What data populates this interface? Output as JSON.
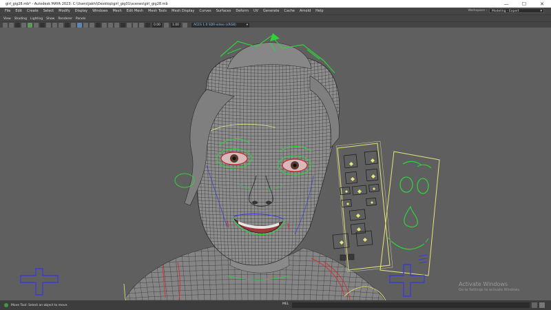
{
  "window": {
    "title": "girl_gig28.mb* - Autodesk MAYA 2023: C:\\Users\\Jakhi\\Desktop\\girl_gig01\\scenes\\girl_gig28.mb",
    "minimize": "—",
    "maximize": "☐",
    "close": "✕"
  },
  "menubar": {
    "items": [
      "File",
      "Edit",
      "Create",
      "Select",
      "Modify",
      "Display",
      "Windows",
      "Mesh",
      "Edit Mesh",
      "Mesh Tools",
      "Mesh Display",
      "Curves",
      "Surfaces",
      "Deform",
      "UV",
      "Generate",
      "Cache",
      "Arnold",
      "Help"
    ],
    "workspace_label": "Workspace :",
    "workspace_value": "Modeling - Expert"
  },
  "panel_menu": {
    "items": [
      "View",
      "Shading",
      "Lighting",
      "Show",
      "Renderer",
      "Panels"
    ]
  },
  "shelf": {
    "field1": "0.00",
    "field2": "1.00",
    "colorspace": "ACES 1.0 SDR-video (sRGB)"
  },
  "status": {
    "message": "Move Tool: Select an object to move.",
    "command_label": "MEL"
  },
  "watermark": {
    "title": "Activate Windows",
    "subtitle": "Go to Settings to activate Windows."
  },
  "colors": {
    "wire": "#1c1c1c",
    "mesh": "#8a8a8a",
    "control_green": "#2fd23a",
    "control_yellow": "#e8e87a",
    "locator_blue": "#3b3bd8",
    "curve_red": "#d83030"
  }
}
